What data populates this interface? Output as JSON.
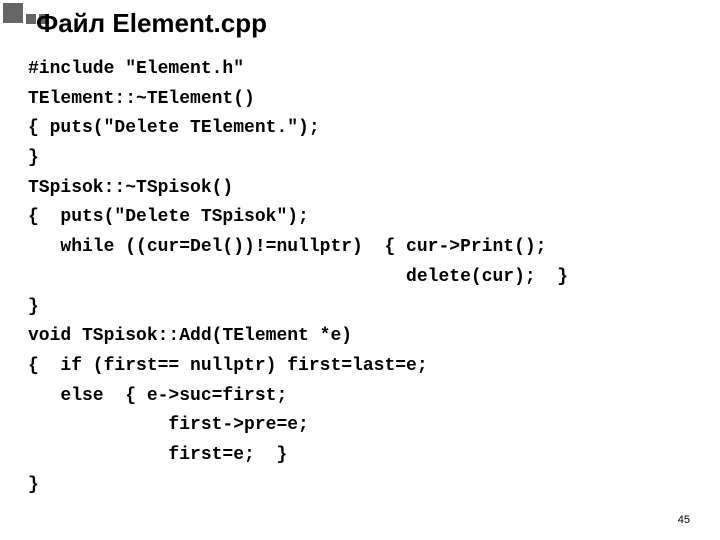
{
  "title": "Файл Element.cpp",
  "code_lines": [
    "#include \"Element.h\"",
    "TElement::~TElement()",
    "{ puts(\"Delete TElement.\");",
    "}",
    "TSpisok::~TSpisok()",
    "{  puts(\"Delete TSpisok\");",
    "   while ((cur=Del())!=nullptr)  { cur->Print();",
    "                                   delete(cur);  }",
    "}",
    "void TSpisok::Add(TElement *e)",
    "{  if (first== nullptr) first=last=e;",
    "   else  { e->suc=first;",
    "             first->pre=e;",
    "             first=e;  }",
    "}"
  ],
  "page_number": "45"
}
